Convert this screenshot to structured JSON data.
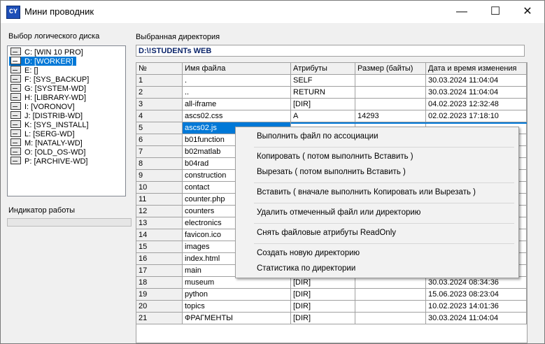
{
  "window": {
    "title": "Мини проводник",
    "icon_text": "CY",
    "minimize_icon": "minimize-icon",
    "maximize_icon": "maximize-icon",
    "close_icon": "close-icon"
  },
  "left": {
    "drive_label": "Выбор логического диска",
    "drives": [
      "C: [WIN 10 PRO]",
      "D: [WORKER]",
      "E: []",
      "F: [SYS_BACKUP]",
      "G: [SYSTEM-WD]",
      "H: [LIBRARY-WD]",
      "I: [VORONOV]",
      "J: [DISTRIB-WD]",
      "K: [SYS_INSTALL]",
      "L: [SERG-WD]",
      "M: [NATALY-WD]",
      "O: [OLD_OS-WD]",
      "P: [ARCHIVE-WD]"
    ],
    "selected_drive": 1,
    "work_label": "Индикатор работы",
    "progress": 0
  },
  "right": {
    "dir_label": "Выбранная директория",
    "path": "D:\\!STUDENTs WEB",
    "columns": [
      "№",
      "Имя файла",
      "Атрибуты",
      "Размер (байты)",
      "Дата и время изменения"
    ],
    "rows": [
      [
        "1",
        ".",
        " SELF",
        "",
        "30.03.2024 11:04:04"
      ],
      [
        "2",
        "..",
        " RETURN",
        "",
        "30.03.2024 11:04:04"
      ],
      [
        "3",
        "all-iframe",
        "[DIR]",
        "",
        "04.02.2023 12:32:48"
      ],
      [
        "4",
        "ascs02.css",
        "A",
        " 14293",
        "02.02.2023 17:18:10"
      ],
      [
        "5",
        "ascs02.js",
        "",
        "",
        ""
      ],
      [
        "6",
        "b01function",
        "",
        "",
        ""
      ],
      [
        "7",
        "b02matlab",
        "",
        "",
        ""
      ],
      [
        "8",
        "b04rad",
        "",
        "",
        ""
      ],
      [
        "9",
        "construction",
        "",
        "",
        ""
      ],
      [
        "10",
        "contact",
        "",
        "",
        ""
      ],
      [
        "11",
        "counter.php",
        "",
        "",
        ""
      ],
      [
        "12",
        "counters",
        "",
        "",
        ""
      ],
      [
        "13",
        "electronics",
        "",
        "",
        ""
      ],
      [
        "14",
        "favicon.ico",
        "",
        "",
        ""
      ],
      [
        "15",
        "images",
        "",
        "",
        ""
      ],
      [
        "16",
        "index.html",
        "",
        "",
        ""
      ],
      [
        "17",
        "main",
        "",
        "",
        ""
      ],
      [
        "18",
        "museum",
        "[DIR]",
        "",
        "30.03.2024 08:34:36"
      ],
      [
        "19",
        "python",
        "[DIR]",
        "",
        "15.06.2023 08:23:04"
      ],
      [
        "20",
        "topics",
        "[DIR]",
        "",
        "10.02.2023 14:01:36"
      ],
      [
        "21",
        "ФРАГМЕНТЫ",
        "[DIR]",
        "",
        "30.03.2024 11:04:04"
      ]
    ],
    "selected_row": 4
  },
  "context_menu": [
    "Выполнить файл по ассоциации",
    "Копировать ( потом выполнить Вставить )",
    "Вырезать ( потом выполнить Вставить )",
    "Вставить ( вначале выполнить Копировать или Вырезать )",
    "Удалить отмеченный файл или директорию",
    "Снять файловые атрибуты ReadOnly",
    "Создать новую директорию",
    "Статистика по директории"
  ]
}
